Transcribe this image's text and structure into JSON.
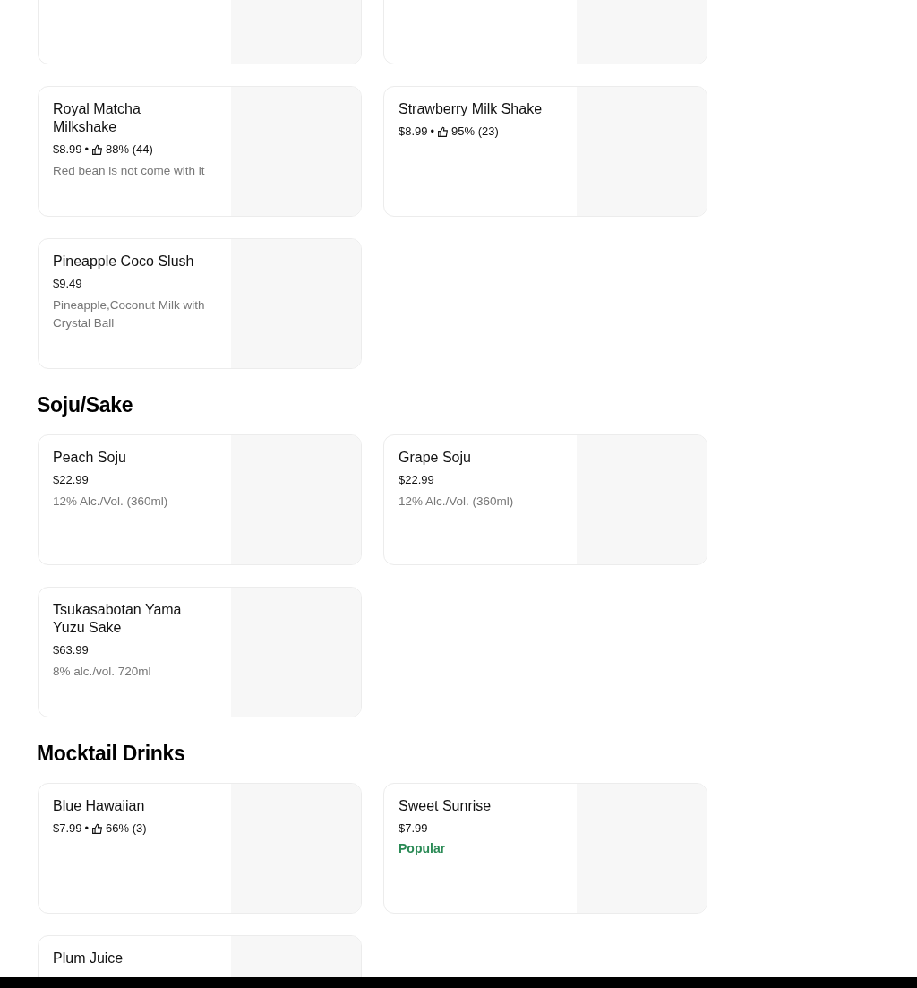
{
  "sections": [
    {
      "items": [
        {
          "kind": "cut"
        },
        {
          "kind": "cut"
        }
      ]
    },
    {
      "items": [
        {
          "kind": "dish",
          "name": "Royal Matcha Milkshake",
          "price": "$8.99",
          "rating": {
            "separator": "•",
            "text": "88% (44)"
          },
          "description": "Red bean is not come with it"
        },
        {
          "kind": "dish",
          "name": "Strawberry Milk Shake",
          "price": "$8.99",
          "rating": {
            "separator": "•",
            "text": "95% (23)"
          }
        },
        {
          "kind": "dish",
          "name": "Pineapple Coco Slush",
          "price": "$9.49",
          "description": "Pineapple,Coconut Milk with Crystal Ball"
        }
      ]
    },
    {
      "title": "Soju/Sake",
      "items": [
        {
          "kind": "dish",
          "name": "Peach Soju",
          "price": "$22.99",
          "description": "12% Alc./Vol. (360ml)"
        },
        {
          "kind": "dish",
          "name": "Grape Soju",
          "price": "$22.99",
          "description": "12% Alc./Vol. (360ml)"
        },
        {
          "kind": "dish",
          "name": "Tsukasabotan Yama Yuzu Sake",
          "price": "$63.99",
          "description": "8% alc./vol. 720ml"
        }
      ]
    },
    {
      "title": "Mocktail Drinks",
      "items": [
        {
          "kind": "dish",
          "name": "Blue Hawaiian",
          "price": "$7.99",
          "rating": {
            "separator": "•",
            "text": "66% (3)"
          }
        },
        {
          "kind": "dish",
          "name": "Sweet Sunrise",
          "price": "$7.99",
          "badge": "Popular"
        },
        {
          "kind": "dish",
          "name": "Plum Juice"
        }
      ]
    }
  ]
}
